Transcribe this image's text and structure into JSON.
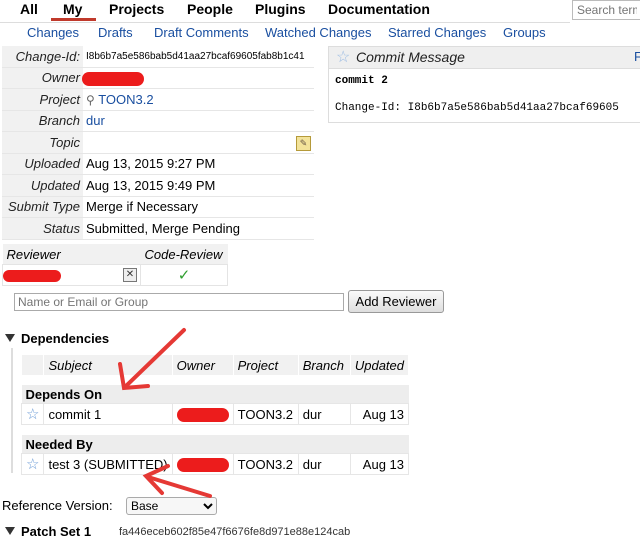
{
  "topnav": {
    "all": "All",
    "my": "My",
    "projects": "Projects",
    "people": "People",
    "plugins": "Plugins",
    "documentation": "Documentation",
    "search_placeholder": "Search term"
  },
  "subnav": {
    "changes": "Changes",
    "drafts": "Drafts",
    "draft_comments": "Draft Comments",
    "watched": "Watched Changes",
    "starred": "Starred Changes",
    "groups": "Groups"
  },
  "info": {
    "change_id_label": "Change-Id:",
    "change_id": "I8b6b7a5e586bab5d41aa27bcaf69605fab8b1c41",
    "owner_label": "Owner",
    "project_label": "Project",
    "project": "TOON3.2",
    "branch_label": "Branch",
    "branch": "dur",
    "topic_label": "Topic",
    "uploaded_label": "Uploaded",
    "uploaded": "Aug 13, 2015 9:27 PM",
    "updated_label": "Updated",
    "updated": "Aug 13, 2015 9:49 PM",
    "submit_type_label": "Submit Type",
    "submit_type": "Merge if Necessary",
    "status_label": "Status",
    "status": "Submitted, Merge Pending"
  },
  "commit_message": {
    "title": "Commit Message",
    "line1": "commit 2",
    "line2": "Change-Id: I8b6b7a5e586bab5d41aa27bcaf69605",
    "right_marker": "F"
  },
  "reviewers": {
    "col_reviewer": "Reviewer",
    "col_code_review": "Code-Review",
    "vote": "✓"
  },
  "add_reviewer": {
    "placeholder": "Name or Email or Group",
    "button": "Add Reviewer"
  },
  "dependencies": {
    "title": "Dependencies",
    "headers": [
      "Subject",
      "Owner",
      "Project",
      "Branch",
      "Updated"
    ],
    "depends_on_label": "Depends On",
    "needed_by_label": "Needed By",
    "depends_on": [
      {
        "subject": "commit 1",
        "project": "TOON3.2",
        "branch": "dur",
        "updated": "Aug 13"
      }
    ],
    "needed_by": [
      {
        "subject": "test 3 (SUBMITTED)",
        "project": "TOON3.2",
        "branch": "dur",
        "updated": "Aug 13"
      }
    ]
  },
  "reference": {
    "label": "Reference Version:",
    "selected": "Base"
  },
  "patch_set": {
    "label": "Patch Set 1",
    "hash": "fa446eceb602f85e47f6676fe8d971e88e124cab"
  },
  "colors": {
    "accent": "#c0392b",
    "link": "#1a4fa0",
    "redaction": "#ec1c1c",
    "annotation_arrow": "#e53935"
  }
}
